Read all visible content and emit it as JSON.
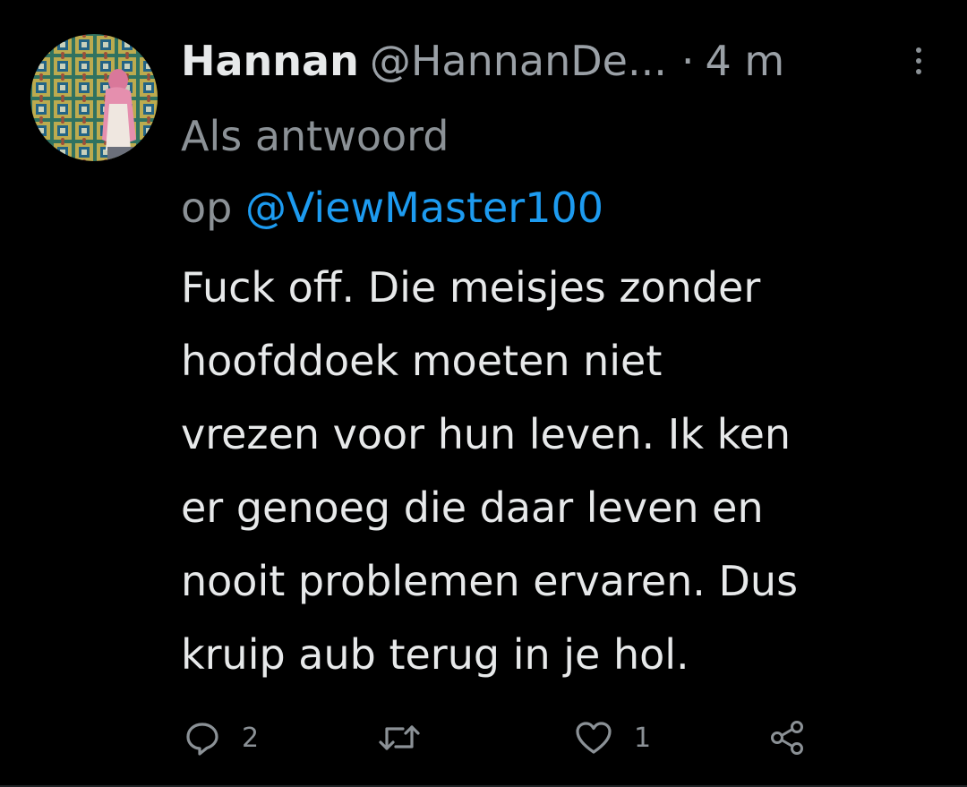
{
  "tweet": {
    "display_name": "Hannan",
    "handle": "@HannanDe...",
    "separator": "·",
    "time": "4 m",
    "reply_prefix": "Als antwoord",
    "reply_on": "op",
    "reply_mention": "@ViewMaster100",
    "text_lines": [
      "Fuck off. Die meisjes zonder",
      "hoofddoek moeten niet",
      "vrezen voor hun leven. Ik ken",
      "er genoeg die daar leven en",
      "nooit problemen ervaren. Dus",
      "kruip aub terug in je hol."
    ]
  },
  "actions": {
    "reply_count": "2",
    "retweet_count": "",
    "like_count": "1"
  },
  "colors": {
    "background": "#000000",
    "text": "#e7e9ea",
    "secondary": "#8b9196",
    "mention": "#1d9bf0"
  },
  "icons": {
    "reply": "speech-bubble-icon",
    "retweet": "retweet-icon",
    "like": "heart-icon",
    "share": "share-icon",
    "more": "vertical-dots-icon"
  }
}
